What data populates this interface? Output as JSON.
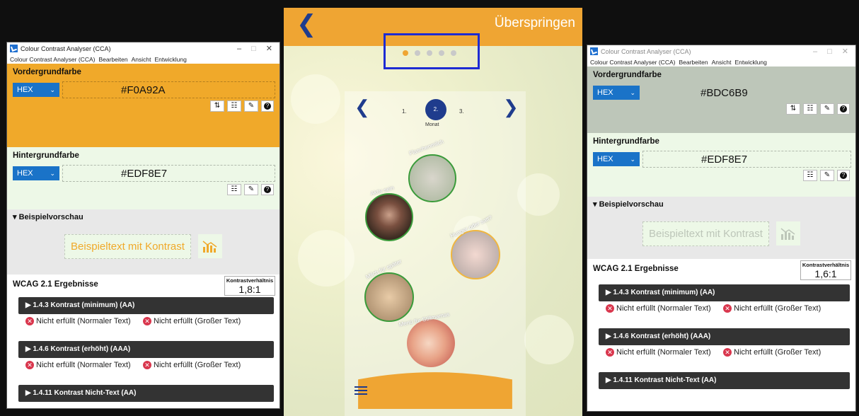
{
  "left_app": {
    "title": "Colour Contrast Analyser (CCA)",
    "menu": [
      "Colour Contrast Analyser (CCA)",
      "Bearbeiten",
      "Ansicht",
      "Entwicklung"
    ],
    "foreground": {
      "label": "Vordergrundfarbe",
      "format": "HEX",
      "value": "#F0A92A",
      "bg_color": "#F0A92A"
    },
    "background": {
      "label": "Hintergrundfarbe",
      "format": "HEX",
      "value": "#EDF8E7",
      "bg_color": "#EDF8E7"
    },
    "preview": {
      "label": "▾ Beispielvorschau",
      "sample_text": "Beispieltext mit Kontrast"
    },
    "wcag": {
      "label": "WCAG 2.1 Ergebnisse",
      "ratio_label": "Kontrastverhältnis",
      "ratio": "1,8:1",
      "sections": [
        {
          "title": "▶ 1.4.3 Kontrast (minimum) (AA)",
          "result1": "Nicht erfüllt (Normaler Text)",
          "result2": "Nicht erfüllt (Großer Text)"
        },
        {
          "title": "▶ 1.4.6 Kontrast (erhöht) (AAA)",
          "result1": "Nicht erfüllt (Normaler Text)",
          "result2": "Nicht erfüllt (Großer Text)"
        },
        {
          "title": "▶ 1.4.11 Kontrast Nicht-Text (AA)"
        }
      ]
    }
  },
  "right_app": {
    "title": "Colour Contrast Analyser (CCA)",
    "menu": [
      "Colour Contrast Analyser (CCA)",
      "Bearbeiten",
      "Ansicht",
      "Entwicklung"
    ],
    "foreground": {
      "label": "Vordergrundfarbe",
      "format": "HEX",
      "value": "#BDC6B9",
      "bg_color": "#BDC6B9"
    },
    "background": {
      "label": "Hintergrundfarbe",
      "format": "HEX",
      "value": "#EDF8E7",
      "bg_color": "#EDF8E7"
    },
    "preview": {
      "label": "▾ Beispielvorschau",
      "sample_text": "Beispieltext mit Kontrast"
    },
    "wcag": {
      "label": "WCAG 2.1 Ergebnisse",
      "ratio_label": "Kontrastverhältnis",
      "ratio": "1,6:1",
      "sections": [
        {
          "title": "▶ 1.4.3 Kontrast (minimum) (AA)",
          "result1": "Nicht erfüllt (Normaler Text)",
          "result2": "Nicht erfüllt (Großer Text)"
        },
        {
          "title": "▶ 1.4.6 Kontrast (erhöht) (AAA)",
          "result1": "Nicht erfüllt (Normaler Text)",
          "result2": "Nicht erfüllt (Großer Text)"
        },
        {
          "title": "▶ 1.4.11 Kontrast Nicht-Text (AA)"
        }
      ]
    }
  },
  "phone": {
    "skip_label": "Überspringen",
    "page_dots": {
      "total": 5,
      "active": 1
    },
    "steps": [
      "1.",
      "2.",
      "3."
    ],
    "step_caption": "Monat",
    "bubbles": [
      "Flaschenmilch",
      "Aktiv sein",
      "Hunger oder satt?",
      "Milch für später",
      "Menü für Stillmamas"
    ],
    "accent_color": "#EFA533",
    "nav_color": "#1F3C8D"
  },
  "icons": {
    "back": "chevron-left-icon",
    "swap": "swap-icon",
    "sliders": "sliders-icon",
    "eyedropper": "eyedropper-icon",
    "help": "help-icon",
    "fail": "x-circle-icon"
  }
}
